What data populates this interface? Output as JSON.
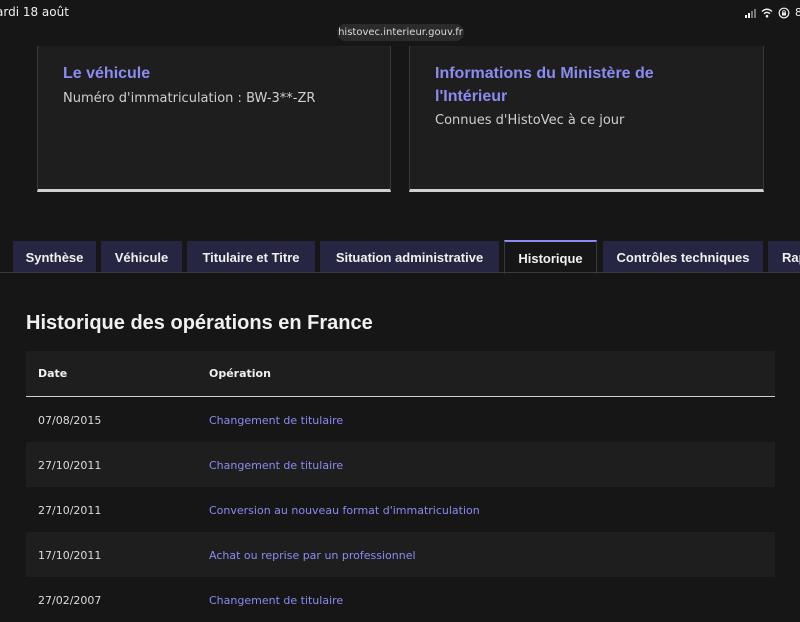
{
  "status_bar": {
    "time": "ardi 18 août",
    "battery": "8"
  },
  "browser": {
    "url": "histovec.interieur.gouv.fr"
  },
  "cards": {
    "vehicle": {
      "title": "Le véhicule",
      "text": "Numéro d'immatriculation : BW-3**-ZR"
    },
    "ministry": {
      "title": "Informations du Ministère de l'Intérieur",
      "text": "Connues d'HistoVec à ce jour"
    }
  },
  "tabs": [
    {
      "label": "Synthèse",
      "active": false
    },
    {
      "label": "Véhicule",
      "active": false
    },
    {
      "label": "Titulaire et Titre",
      "active": false
    },
    {
      "label": "Situation administrative",
      "active": false
    },
    {
      "label": "Historique",
      "active": true
    },
    {
      "label": "Contrôles techniques",
      "active": false
    },
    {
      "label": "Rap",
      "active": false
    }
  ],
  "history": {
    "title": "Historique des opérations en France",
    "columns": {
      "date": "Date",
      "operation": "Opération"
    },
    "rows": [
      {
        "date": "07/08/2015",
        "operation": "Changement de titulaire"
      },
      {
        "date": "27/10/2011",
        "operation": "Changement de titulaire"
      },
      {
        "date": "27/10/2011",
        "operation": "Conversion au nouveau format d'immatriculation"
      },
      {
        "date": "17/10/2011",
        "operation": "Achat ou reprise par un professionnel"
      },
      {
        "date": "27/02/2007",
        "operation": "Changement de titulaire"
      }
    ]
  },
  "colors": {
    "accent": "#8b8bf2",
    "background": "#161616",
    "tab_background": "#262642"
  }
}
